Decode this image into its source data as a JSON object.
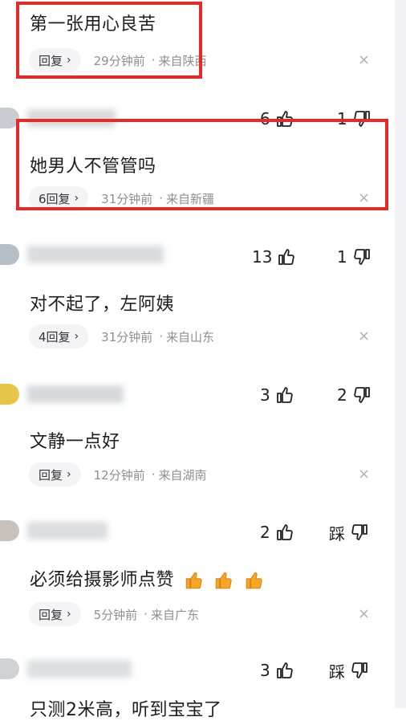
{
  "colors": {
    "highlight": "#e62a2a",
    "meta": "#8e8e93",
    "pill_bg": "#f4f4f6"
  },
  "icons": {
    "like": "thumb-up-icon",
    "dislike": "thumb-down-icon",
    "close": "close-icon",
    "chevron": "chevron-right-icon",
    "emoji": "thumbs-up-emoji"
  },
  "comments": [
    {
      "text": "第一张用心良苦",
      "reply_label": "回复",
      "chevron": "›",
      "time": "29分钟前",
      "location": "来自陕西",
      "likes": "6",
      "dislikes": "1"
    },
    {
      "text": "她男人不管管吗",
      "reply_label": "6回复",
      "chevron": "›",
      "time": "31分钟前",
      "location": "来自新疆",
      "likes": "13",
      "dislikes": "1"
    },
    {
      "text": "对不起了，左阿姨",
      "reply_label": "4回复",
      "chevron": "›",
      "time": "31分钟前",
      "location": "来自山东",
      "likes": "3",
      "dislikes": "2"
    },
    {
      "text": "文静一点好",
      "reply_label": "回复",
      "chevron": "›",
      "time": "12分钟前",
      "location": "来自湖南",
      "likes": "2",
      "dislikes": "踩"
    },
    {
      "text": "必须给摄影师点赞",
      "reply_label": "回复",
      "chevron": "›",
      "time": "5分钟前",
      "location": "来自广东",
      "likes": "3",
      "dislikes": "踩"
    }
  ],
  "partial_text": "只测2米高，听到宝宝了",
  "close_symbol": "×",
  "separator": "·"
}
